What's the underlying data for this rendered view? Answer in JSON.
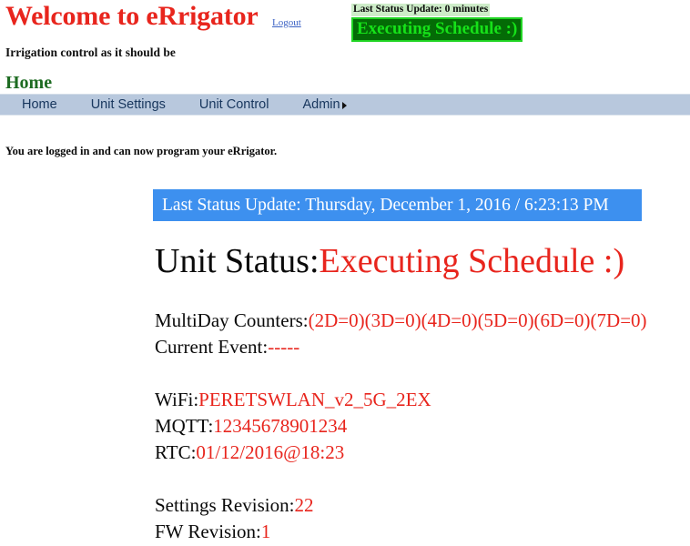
{
  "header": {
    "site_title": "Welcome to eRrigator",
    "logout_label": "Logout",
    "tagline": "Irrigation control as it should be"
  },
  "status_badge": {
    "update_line": "Last Status Update: 0 minutes",
    "state": "Executing Schedule :)",
    "bg_color": "#046b06",
    "text_color": "#16e219",
    "update_bg_color": "#cdecc8"
  },
  "page": {
    "heading": "Home",
    "logged_in_text": "You are logged in and can now program your eRrigator."
  },
  "nav": {
    "items": [
      {
        "label": "Home",
        "has_submenu": false
      },
      {
        "label": "Unit Settings",
        "has_submenu": false
      },
      {
        "label": "Unit Control",
        "has_submenu": false
      },
      {
        "label": "Admin",
        "has_submenu": true
      }
    ],
    "bar_color": "#b8c8dd",
    "text_color": "#17365d"
  },
  "main": {
    "status_banner": "Last Status Update: Thursday, December 1, 2016 / 6:23:13 PM",
    "status_banner_color": "#3d90ef",
    "unit_status_label": "Unit Status:",
    "unit_status_value": "Executing Schedule :)",
    "value_color": "#e8251d",
    "rows": [
      {
        "label": "MultiDay Counters:",
        "value": "(2D=0)(3D=0)(4D=0)(5D=0)(6D=0)(7D=0)"
      },
      {
        "label": "Current Event:",
        "value": "-----"
      },
      {
        "label": "",
        "value": ""
      },
      {
        "label": "WiFi:",
        "value": "PERETSWLAN_v2_5G_2EX"
      },
      {
        "label": "MQTT:",
        "value": "12345678901234"
      },
      {
        "label": "RTC:",
        "value": "01/12/2016@18:23"
      },
      {
        "label": "",
        "value": ""
      },
      {
        "label": "Settings Revision:",
        "value": "22"
      },
      {
        "label": "FW Revision:",
        "value": "1"
      }
    ]
  }
}
